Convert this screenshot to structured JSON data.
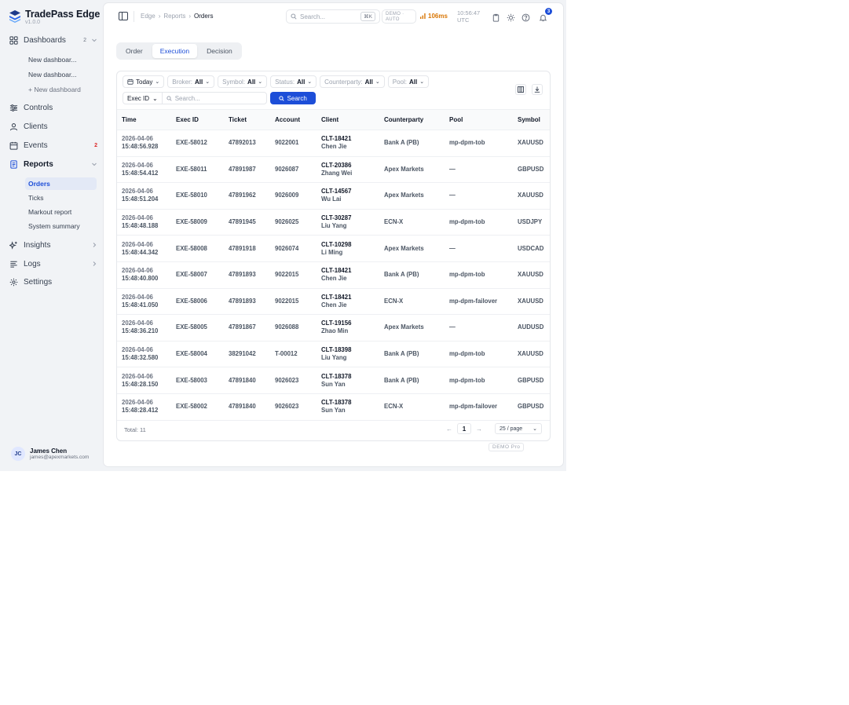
{
  "app": {
    "name": "TradePass Edge",
    "version": "v1.0.0"
  },
  "sidebar": {
    "dashboards": {
      "label": "Dashboards",
      "count": "2"
    },
    "dashboard_items": [
      "New dashboar...",
      "New dashboar...",
      "+ New dashboard"
    ],
    "controls": "Controls",
    "clients": "Clients",
    "events": {
      "label": "Events",
      "count": "2"
    },
    "reports": {
      "label": "Reports"
    },
    "report_items": [
      "Orders",
      "Ticks",
      "Markout report",
      "System summary"
    ],
    "insights": "Insights",
    "logs": "Logs",
    "settings": "Settings"
  },
  "user": {
    "initials": "JC",
    "name": "James Chen",
    "email": "james@apexmarkets.com"
  },
  "topbar": {
    "breadcrumb": [
      "Edge",
      "Reports",
      "Orders"
    ],
    "search_placeholder": "Search...",
    "shortcut": "⌘K",
    "mode_line1": "DEMO ·",
    "mode_line2": "AUTO",
    "latency": "106ms",
    "time": "10:56:47",
    "tz": "UTC",
    "notif_count": "3"
  },
  "tabs": [
    "Order",
    "Execution",
    "Decision"
  ],
  "filters": {
    "date": "Today",
    "broker": {
      "label": "Broker:",
      "value": "All"
    },
    "symbol": {
      "label": "Symbol:",
      "value": "All"
    },
    "status": {
      "label": "Status:",
      "value": "All"
    },
    "counterparty": {
      "label": "Counterparty:",
      "value": "All"
    },
    "pool": {
      "label": "Pool:",
      "value": "All"
    },
    "search_field": "Exec ID",
    "search_placeholder": "Search...",
    "search_button": "Search"
  },
  "table": {
    "columns": [
      "Time",
      "Exec ID",
      "Ticket",
      "Account",
      "Client",
      "Counterparty",
      "Pool",
      "Symbol"
    ],
    "rows": [
      {
        "date": "2026-04-06",
        "time": "15:48:56.928",
        "exec": "EXE-58012",
        "ticket": "47892013",
        "account": "9022001",
        "client_id": "CLT-18421",
        "client_name": "Chen Jie",
        "cp": "Bank A (PB)",
        "pool": "mp-dpm-tob",
        "symbol": "XAUUSD"
      },
      {
        "date": "2026-04-06",
        "time": "15:48:54.412",
        "exec": "EXE-58011",
        "ticket": "47891987",
        "account": "9026087",
        "client_id": "CLT-20386",
        "client_name": "Zhang Wei",
        "cp": "Apex Markets",
        "pool": "—",
        "symbol": "GBPUSD"
      },
      {
        "date": "2026-04-06",
        "time": "15:48:51.204",
        "exec": "EXE-58010",
        "ticket": "47891962",
        "account": "9026009",
        "client_id": "CLT-14567",
        "client_name": "Wu Lai",
        "cp": "Apex Markets",
        "pool": "—",
        "symbol": "XAUUSD"
      },
      {
        "date": "2026-04-06",
        "time": "15:48:48.188",
        "exec": "EXE-58009",
        "ticket": "47891945",
        "account": "9026025",
        "client_id": "CLT-30287",
        "client_name": "Liu Yang",
        "cp": "ECN-X",
        "pool": "mp-dpm-tob",
        "symbol": "USDJPY"
      },
      {
        "date": "2026-04-06",
        "time": "15:48:44.342",
        "exec": "EXE-58008",
        "ticket": "47891918",
        "account": "9026074",
        "client_id": "CLT-10298",
        "client_name": "Li Ming",
        "cp": "Apex Markets",
        "pool": "—",
        "symbol": "USDCAD"
      },
      {
        "date": "2026-04-06",
        "time": "15:48:40.800",
        "exec": "EXE-58007",
        "ticket": "47891893",
        "account": "9022015",
        "client_id": "CLT-18421",
        "client_name": "Chen Jie",
        "cp": "Bank A (PB)",
        "pool": "mp-dpm-tob",
        "symbol": "XAUUSD"
      },
      {
        "date": "2026-04-06",
        "time": "15:48:41.050",
        "exec": "EXE-58006",
        "ticket": "47891893",
        "account": "9022015",
        "client_id": "CLT-18421",
        "client_name": "Chen Jie",
        "cp": "ECN-X",
        "pool": "mp-dpm-failover",
        "symbol": "XAUUSD"
      },
      {
        "date": "2026-04-06",
        "time": "15:48:36.210",
        "exec": "EXE-58005",
        "ticket": "47891867",
        "account": "9026088",
        "client_id": "CLT-19156",
        "client_name": "Zhao Min",
        "cp": "Apex Markets",
        "pool": "—",
        "symbol": "AUDUSD"
      },
      {
        "date": "2026-04-06",
        "time": "15:48:32.580",
        "exec": "EXE-58004",
        "ticket": "38291042",
        "account": "T-00012",
        "client_id": "CLT-18398",
        "client_name": "Liu Yang",
        "cp": "Bank A (PB)",
        "pool": "mp-dpm-tob",
        "symbol": "XAUUSD"
      },
      {
        "date": "2026-04-06",
        "time": "15:48:28.150",
        "exec": "EXE-58003",
        "ticket": "47891840",
        "account": "9026023",
        "client_id": "CLT-18378",
        "client_name": "Sun Yan",
        "cp": "Bank A (PB)",
        "pool": "mp-dpm-tob",
        "symbol": "GBPUSD"
      },
      {
        "date": "2026-04-06",
        "time": "15:48:28.412",
        "exec": "EXE-58002",
        "ticket": "47891840",
        "account": "9026023",
        "client_id": "CLT-18378",
        "client_name": "Sun Yan",
        "cp": "ECN-X",
        "pool": "mp-dpm-failover",
        "symbol": "GBPUSD"
      }
    ]
  },
  "pagination": {
    "total": "Total: 11",
    "page": "1",
    "page_size": "25 / page",
    "prev": "←",
    "next": "→"
  },
  "watermark": "DEMO Pro",
  "colors": {
    "accent": "#1d4ed8",
    "latency": "#d97706",
    "badge_red": "#dc2626"
  }
}
